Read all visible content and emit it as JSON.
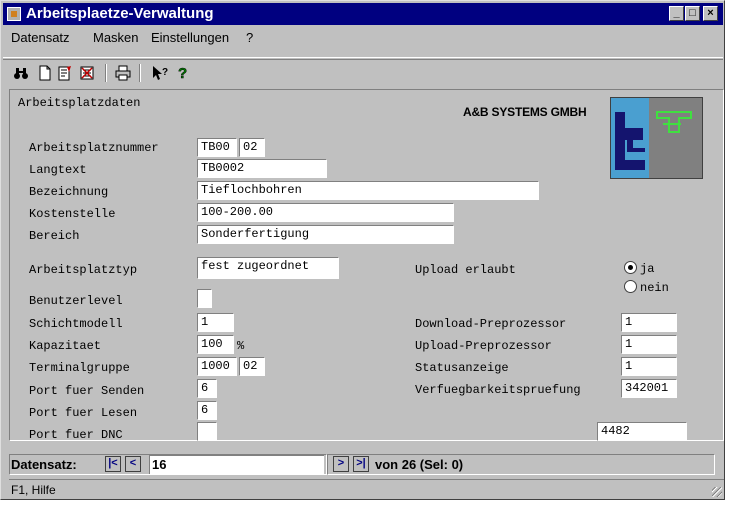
{
  "window": {
    "title": "Arbeitsplaetze-Verwaltung",
    "controls": {
      "minimize": "_",
      "maximize": "□",
      "close": "×"
    }
  },
  "menu": [
    {
      "label": "Datensatz",
      "accel": "D"
    },
    {
      "label": "Masken",
      "accel": "M"
    },
    {
      "label": "Einstellungen",
      "accel": "E"
    },
    {
      "label": "?",
      "accel": "?"
    }
  ],
  "toolbar": {
    "icons": [
      "binoculars-icon",
      "new-document-icon",
      "edit-document-icon",
      "delete-document-icon",
      "print-icon",
      "context-help-icon",
      "help-icon"
    ]
  },
  "form": {
    "section_title": "Arbeitsplatzdaten",
    "company": "A&B SYSTEMS GMBH",
    "arbeitsplatznummer": {
      "label": "Arbeitsplatznummer",
      "value1": "TB00",
      "value2": "02"
    },
    "langtext": {
      "label": "Langtext",
      "value": "TB0002"
    },
    "bezeichnung": {
      "label": "Bezeichnung",
      "value": "Tieflochbohren"
    },
    "kostenstelle": {
      "label": "Kostenstelle",
      "value": "100-200.00"
    },
    "bereich": {
      "label": "Bereich",
      "value": "Sonderfertigung"
    },
    "arbeitsplatztyp": {
      "label": "Arbeitsplatztyp",
      "value": "fest zugeordnet"
    },
    "benutzerlevel": {
      "label": "Benutzerlevel",
      "value": ""
    },
    "schichtmodell": {
      "label": "Schichtmodell",
      "value": "1"
    },
    "kapazitaet": {
      "label": "Kapazitaet",
      "value": "100",
      "unit": "%"
    },
    "terminalgruppe": {
      "label": "Terminalgruppe",
      "value1": "1000",
      "value2": "02"
    },
    "port_senden": {
      "label": "Port fuer Senden",
      "value": "6"
    },
    "port_lesen": {
      "label": "Port fuer Lesen",
      "value": "6"
    },
    "port_dnc": {
      "label": "Port fuer DNC",
      "value": ""
    },
    "upload_erlaubt": {
      "label": "Upload erlaubt",
      "options": [
        "ja",
        "nein"
      ],
      "selected": "ja"
    },
    "download_preprozessor": {
      "label": "Download-Preprozessor",
      "value": "1"
    },
    "upload_preprozessor": {
      "label": "Upload-Preprozessor",
      "value": "1"
    },
    "statusanzeige": {
      "label": "Statusanzeige",
      "value": "1"
    },
    "verfuegbarkeitspruefung": {
      "label": "Verfuegbarkeitspruefung",
      "value": "342001"
    },
    "extra_field": {
      "value": "4482"
    }
  },
  "navigation": {
    "label": "Datensatz:",
    "current": "16",
    "of_text": "von 26 (Sel: 0)",
    "first": "|<",
    "prev": "<",
    "next": ">",
    "last": ">|"
  },
  "status": {
    "help_text": "F1, Hilfe"
  }
}
